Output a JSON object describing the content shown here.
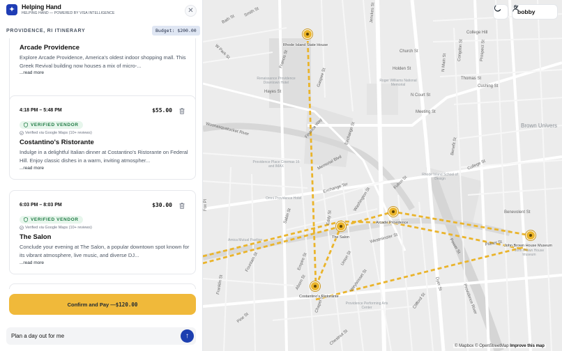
{
  "app": {
    "title": "Helping Hand",
    "subtitle": "HELPING HAND — POWERED BY VISA INTELLIGENCE",
    "logo_icon": "sparkle-icon",
    "close_icon": "close-icon"
  },
  "itinerary": {
    "title": "PROVIDENCE, RI ITINERARY",
    "budget": "Budget: $200.00"
  },
  "cards": [
    {
      "time": "",
      "price": "",
      "verified_badge": "",
      "verified_note": "",
      "name": "Arcade Providence",
      "description": "Explore Arcade Providence, America's oldest indoor shopping mall. This Greek Revival building now houses a mix of micro-...",
      "read_more": "...read more"
    },
    {
      "time": "4:18 PM – 5:48 PM",
      "price": "$55.00",
      "verified_badge": "VERIFIED VENDOR",
      "verified_note": "Verified via Google Maps (10+ reviews)",
      "name": "Costantino's Ristorante",
      "description": "Indulge in a delightful Italian dinner at Costantino's Ristorante on Federal Hill. Enjoy classic dishes in a warm, inviting atmospher...",
      "read_more": "...read more"
    },
    {
      "time": "6:03 PM – 8:03 PM",
      "price": "$30.00",
      "verified_badge": "VERIFIED VENDOR",
      "verified_note": "Verified via Google Maps (10+ reviews)",
      "name": "The Salon",
      "description": "Conclude your evening at The Salon, a popular downtown spot known for its vibrant atmosphere, live music, and diverse DJ...",
      "read_more": "...read more"
    }
  ],
  "confirm": {
    "label": "Confirm and Pay — ",
    "amount": "$120.00"
  },
  "chat": {
    "value": "Plan a day out for me",
    "send_icon": "arrow-up-icon"
  },
  "map": {
    "user_name": "bobby",
    "theme_icon": "moon-icon",
    "user_icon": "user-icon",
    "route_color": "#eab42b",
    "pins": [
      {
        "label": "Rhode Island State House"
      },
      {
        "label": "The Salon"
      },
      {
        "label": "Arcade Providence"
      },
      {
        "label": "John Brown House Museum"
      },
      {
        "label": "Costantino's Ristorante"
      }
    ],
    "streets": {
      "gaspee": "Gaspee St",
      "hayes": "Hayes St",
      "exchange_st": "Exchange St",
      "francis": "Francis St",
      "finance": "Finance Way",
      "memorial": "Memorial Blvd",
      "exchange_ter": "Exchange Ter",
      "washington": "Washington St",
      "fulton": "Fulton St",
      "sabin": "Sabin St",
      "weybosset": "Weybosset St",
      "westminster": "Westminster St",
      "empire": "Empire St",
      "union": "Union St",
      "chapel": "Chapel St",
      "fountain": "Fountain St",
      "aborn": "Aborn St",
      "franklin": "Franklin St",
      "chestnut": "Chestnut St",
      "clifford": "Clifford St",
      "dyer": "Dyer St",
      "eddy": "Eddy St",
      "pine": "Pine St",
      "pike": "Pike St",
      "college_hill": "College Hill",
      "church": "Church St",
      "holden": "Holden St",
      "north_main": "N Main St",
      "thomas": "Thomas St",
      "n_court": "N Court St",
      "cushing": "Cushing St",
      "meeting": "Meeting St",
      "congdon": "Congdon St",
      "prospect": "Prospect St",
      "benefit": "Benefit St",
      "college": "College St",
      "benevolent": "Benevolent St",
      "wickenden": "Wickenden St",
      "angell": "Angell St",
      "power": "Power St",
      "planet": "Planet St",
      "providence_river": "Providence River",
      "woonasquatucket": "Woonasquatucket River",
      "w_park": "W Park St",
      "bath": "Bath St",
      "jenckes": "Jenckes St",
      "smith": "Smith St",
      "fox": "Fox Pl"
    },
    "places": {
      "roger_williams": "Roger Williams National Memorial",
      "renaissance": "Renaissance Providence Downtown Hotel",
      "providence_place": "Providence Place Cinemas 16 and IMAX",
      "risd": "Rhode Island School of Design",
      "omni": "Omni Providence Hotel",
      "amica": "Amica Mutual Pavilion",
      "ppac": "Providence Performing Arts Center",
      "brown": "Brown Univers",
      "jbh_museum": "John Brown House Museum"
    },
    "attribution": {
      "mapbox": "© Mapbox",
      "osm": "© OpenStreetMap",
      "improve": "Improve this map"
    }
  }
}
